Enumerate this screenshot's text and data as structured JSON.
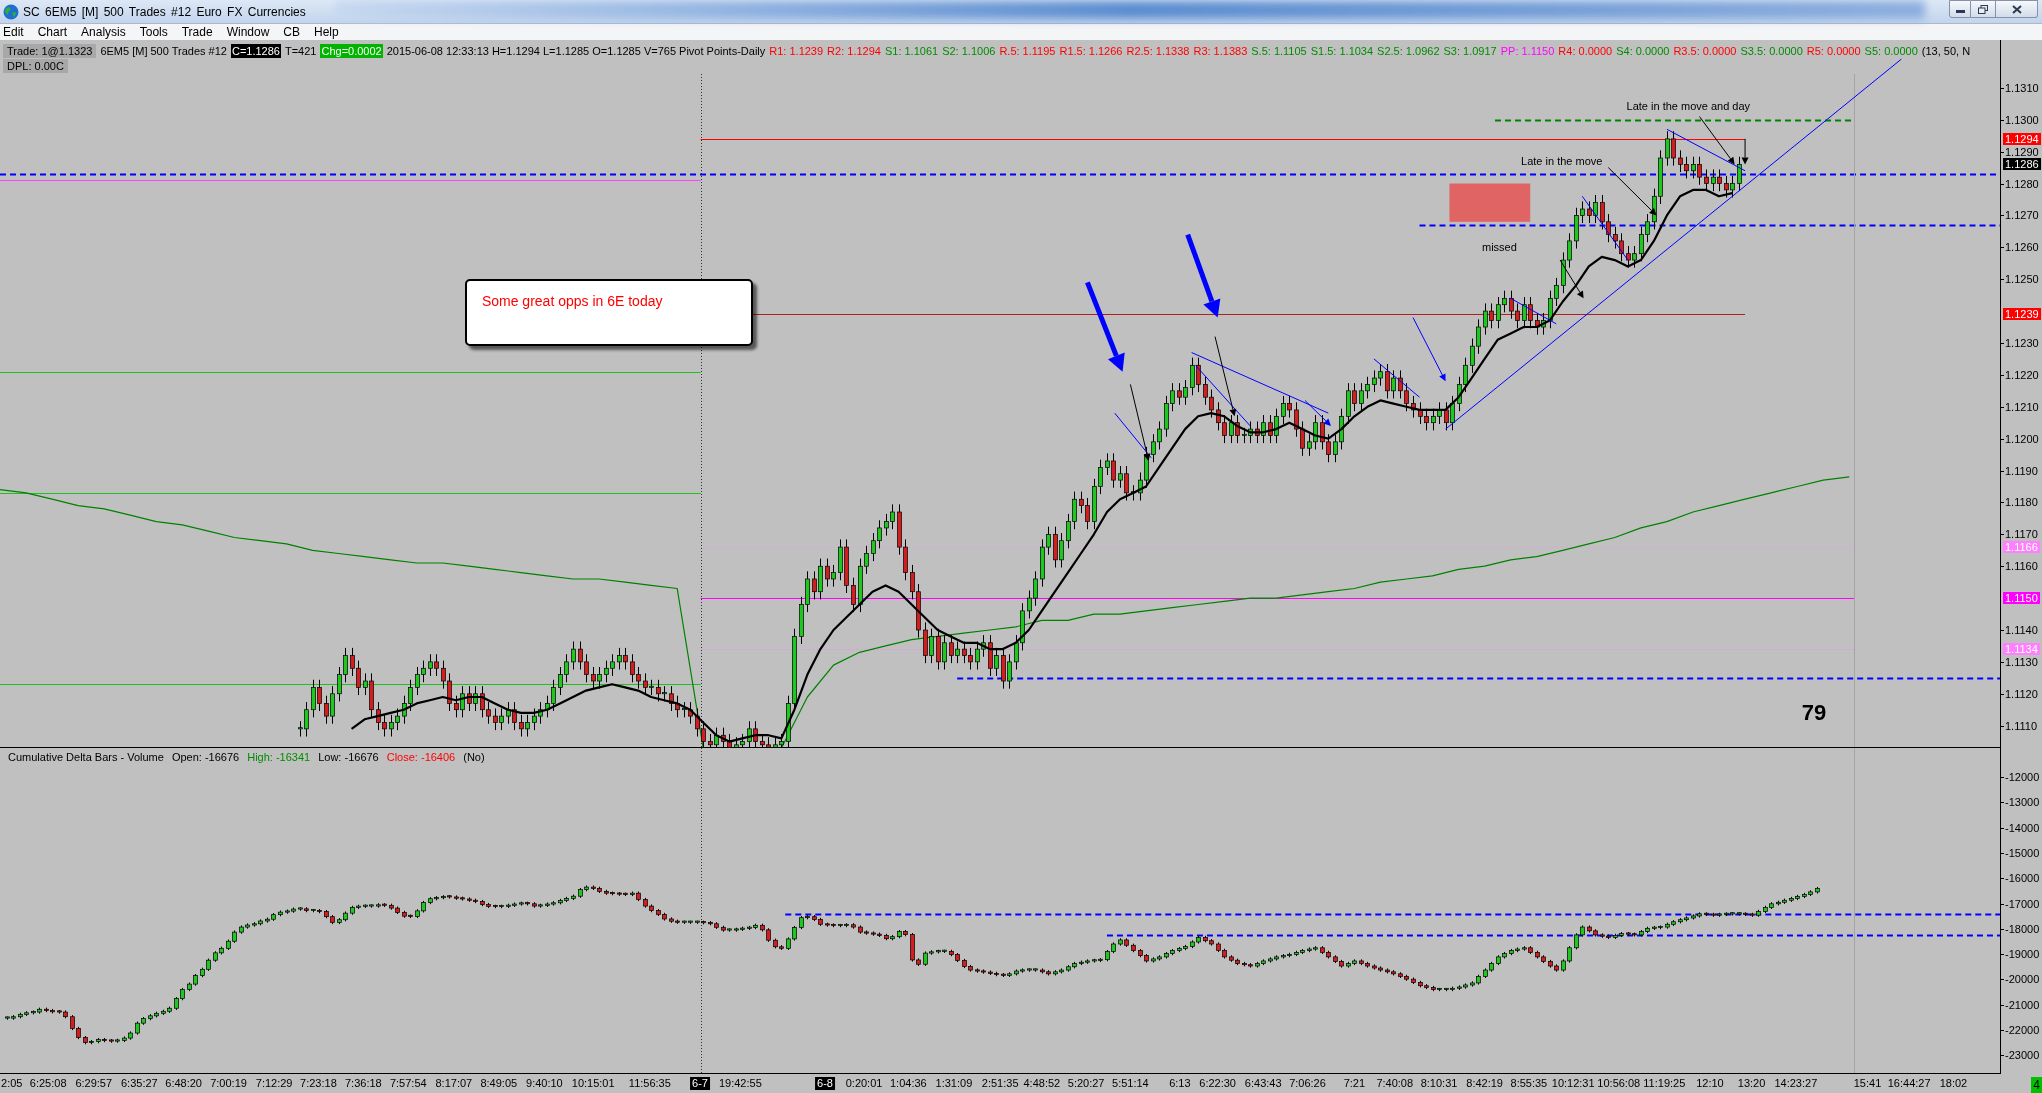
{
  "window": {
    "title": "SC 6EM5 [M] 500 Trades #12 Euro FX Currencies"
  },
  "menu": [
    "Edit",
    "Chart",
    "Analysis",
    "Tools",
    "Trade",
    "Window",
    "CB",
    "Help"
  ],
  "info_line": [
    {
      "text": "Trade: 1@1.1323",
      "kind": "trade"
    },
    {
      "text": "6EM5 [M] 500 Trades #12",
      "kind": "plain"
    },
    {
      "text": "C=1.1286",
      "kind": "inverse"
    },
    {
      "text": "T=421",
      "kind": "plain"
    },
    {
      "text": "Chg=0.0002",
      "kind": "change"
    },
    {
      "text": "2015-06-08 12:33:13 H=1.1294 L=1.1285 O=1.1285 V=765 Pivot Points-Daily",
      "kind": "plain"
    },
    {
      "text": "R1: 1.1239",
      "kind": "resistance"
    },
    {
      "text": "R2: 1.1294",
      "kind": "resistance"
    },
    {
      "text": "S1: 1.1061",
      "kind": "support"
    },
    {
      "text": "S2: 1.1006",
      "kind": "support"
    },
    {
      "text": "R.5: 1.1195",
      "kind": "resistance"
    },
    {
      "text": "R1.5: 1.1266",
      "kind": "resistance"
    },
    {
      "text": "R2.5: 1.1338",
      "kind": "resistance"
    },
    {
      "text": "R3: 1.1383",
      "kind": "resistance"
    },
    {
      "text": "S.5: 1.1105",
      "kind": "support"
    },
    {
      "text": "S1.5: 1.1034",
      "kind": "support"
    },
    {
      "text": "S2.5: 1.0962",
      "kind": "support"
    },
    {
      "text": "S3: 1.0917",
      "kind": "support"
    },
    {
      "text": "PP: 1.1150",
      "kind": "pivot"
    },
    {
      "text": "R4: 0.0000",
      "kind": "resistance"
    },
    {
      "text": "S4: 0.0000",
      "kind": "support"
    },
    {
      "text": "R3.5: 0.0000",
      "kind": "resistance"
    },
    {
      "text": "S3.5: 0.0000",
      "kind": "support"
    },
    {
      "text": "R5: 0.0000",
      "kind": "resistance"
    },
    {
      "text": "S5: 0.0000",
      "kind": "support"
    },
    {
      "text": "(13, 50, N",
      "kind": "plain"
    }
  ],
  "info_line_2": [
    {
      "text": "DPL: 0.00C",
      "kind": "trade"
    }
  ],
  "main_pane": {
    "notes": [
      "Late in the move and day",
      "Late in the move",
      "missed"
    ],
    "callout": {
      "text": "Some great opps in 6E today"
    },
    "bar_counter": {
      "text": "79"
    },
    "price_markers": [
      {
        "label": "1.1294",
        "color": "#ff0000"
      },
      {
        "label": "1.1286",
        "color": "#000000"
      },
      {
        "label": "1.1239",
        "color": "#ff0000"
      },
      {
        "label": "1.1166",
        "color": "#ff80ff"
      },
      {
        "label": "1.1150",
        "color": "#ff00ff"
      },
      {
        "label": "1.1134",
        "color": "#ff80ff"
      }
    ],
    "price_axis": [
      "1.1310",
      "1.1300",
      "1.1290",
      "1.1280",
      "1.1270",
      "1.1260",
      "1.1250",
      "1.1230",
      "1.1220",
      "1.1210",
      "1.1200",
      "1.1190",
      "1.1180",
      "1.1170",
      "1.1160",
      "1.1140",
      "1.1130",
      "1.1120",
      "1.1110"
    ]
  },
  "lower_pane": {
    "header": [
      {
        "text": "Cumulative Delta Bars - Volume",
        "kind": "plain"
      },
      {
        "text": "Open: -16676",
        "kind": "plain"
      },
      {
        "text": "High: -16341",
        "kind": "up"
      },
      {
        "text": "Low: -16676",
        "kind": "plain"
      },
      {
        "text": "Close: -16406",
        "kind": "down"
      },
      {
        "text": "(No)",
        "kind": "plain"
      }
    ],
    "value_axis": [
      "-12000",
      "-13000",
      "-14000",
      "-15000",
      "-16000",
      "-17000",
      "-18000",
      "-19000",
      "-20000",
      "-21000",
      "-22000",
      "-23000"
    ]
  },
  "time_axis": [
    {
      "text": "2:05",
      "kind": "time"
    },
    {
      "text": "6:25:08",
      "kind": "time"
    },
    {
      "text": "6:29:57",
      "kind": "time"
    },
    {
      "text": "6:35:27",
      "kind": "time"
    },
    {
      "text": "6:48:20",
      "kind": "time"
    },
    {
      "text": "7:00:19",
      "kind": "time"
    },
    {
      "text": "7:12:29",
      "kind": "time"
    },
    {
      "text": "7:23:18",
      "kind": "time"
    },
    {
      "text": "7:36:18",
      "kind": "time"
    },
    {
      "text": "7:57:54",
      "kind": "time"
    },
    {
      "text": "8:17:07",
      "kind": "time"
    },
    {
      "text": "8:49:05",
      "kind": "time"
    },
    {
      "text": "9:40:10",
      "kind": "time"
    },
    {
      "text": "10:15:01",
      "kind": "time"
    },
    {
      "text": "11:56:35",
      "kind": "time"
    },
    {
      "text": "6-7",
      "kind": "date"
    },
    {
      "text": "19:42:55",
      "kind": "time"
    },
    {
      "text": "6-8",
      "kind": "date"
    },
    {
      "text": "0:20:01",
      "kind": "time"
    },
    {
      "text": "1:04:36",
      "kind": "time"
    },
    {
      "text": "1:31:09",
      "kind": "time"
    },
    {
      "text": "2:51:35",
      "kind": "time"
    },
    {
      "text": "4:48:52",
      "kind": "time"
    },
    {
      "text": "5:20:27",
      "kind": "time"
    },
    {
      "text": "5:51:14",
      "kind": "time"
    },
    {
      "text": "6:13",
      "kind": "time"
    },
    {
      "text": "6:22:30",
      "kind": "time"
    },
    {
      "text": "6:43:43",
      "kind": "time"
    },
    {
      "text": "7:06:26",
      "kind": "time"
    },
    {
      "text": "7:21",
      "kind": "time"
    },
    {
      "text": "7:40:08",
      "kind": "time"
    },
    {
      "text": "8:10:31",
      "kind": "time"
    },
    {
      "text": "8:42:19",
      "kind": "time"
    },
    {
      "text": "8:55:35",
      "kind": "time"
    },
    {
      "text": "10:12:31",
      "kind": "time"
    },
    {
      "text": "10:56:08",
      "kind": "time"
    },
    {
      "text": "11:19:25",
      "kind": "time"
    },
    {
      "text": "12:10",
      "kind": "time"
    },
    {
      "text": "13:20",
      "kind": "time"
    },
    {
      "text": "14:23:27",
      "kind": "time"
    },
    {
      "text": "15:41",
      "kind": "time"
    },
    {
      "text": "16:44:27",
      "kind": "time"
    },
    {
      "text": "18:02",
      "kind": "time"
    }
  ],
  "corner_badge": {
    "text": "4"
  }
}
